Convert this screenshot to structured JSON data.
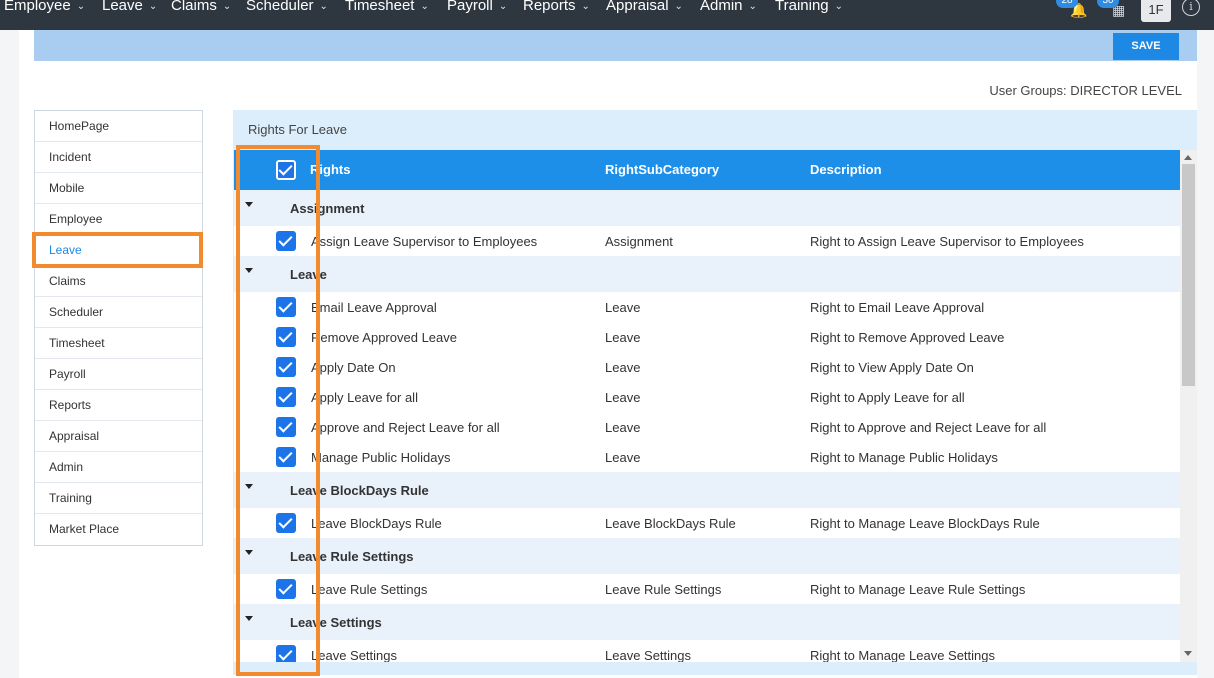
{
  "nav": {
    "items": [
      "Employee",
      "Leave",
      "Claims",
      "Scheduler",
      "Timesheet",
      "Payroll",
      "Reports",
      "Appraisal",
      "Admin",
      "Training"
    ],
    "notification_count": "28",
    "apps_count": "30",
    "user_initials": "1F"
  },
  "toolbar": {
    "save_label": "SAVE"
  },
  "user_groups": "User Groups: DIRECTOR LEVEL",
  "sidebar": {
    "items": [
      "HomePage",
      "Incident",
      "Mobile",
      "Employee",
      "Leave",
      "Claims",
      "Scheduler",
      "Timesheet",
      "Payroll",
      "Reports",
      "Appraisal",
      "Admin",
      "Training",
      "Market Place"
    ],
    "active": "Leave"
  },
  "panel": {
    "title": "Rights For Leave",
    "columns": {
      "rights": "Rights",
      "subcategory": "RightSubCategory",
      "description": "Description"
    },
    "groups": [
      {
        "name": "Assignment",
        "rows": [
          {
            "right": "Assign Leave Supervisor to Employees",
            "sub": "Assignment",
            "desc": "Right to Assign Leave Supervisor to Employees",
            "checked": true
          }
        ]
      },
      {
        "name": "Leave",
        "rows": [
          {
            "right": "Email Leave Approval",
            "sub": "Leave",
            "desc": "Right to Email Leave Approval",
            "checked": true
          },
          {
            "right": "Remove Approved Leave",
            "sub": "Leave",
            "desc": "Right to Remove Approved Leave",
            "checked": true
          },
          {
            "right": "Apply Date On",
            "sub": "Leave",
            "desc": "Right to View Apply Date On",
            "checked": true
          },
          {
            "right": "Apply Leave for all",
            "sub": "Leave",
            "desc": "Right to Apply Leave for all",
            "checked": true
          },
          {
            "right": "Approve and Reject Leave for all",
            "sub": "Leave",
            "desc": "Right to Approve and Reject Leave for all",
            "checked": true
          },
          {
            "right": "Manage Public Holidays",
            "sub": "Leave",
            "desc": "Right to Manage Public Holidays",
            "checked": true
          }
        ]
      },
      {
        "name": "Leave BlockDays Rule",
        "rows": [
          {
            "right": "Leave BlockDays Rule",
            "sub": "Leave BlockDays Rule",
            "desc": "Right to Manage Leave BlockDays Rule",
            "checked": true
          }
        ]
      },
      {
        "name": "Leave Rule Settings",
        "rows": [
          {
            "right": "Leave Rule Settings",
            "sub": "Leave Rule Settings",
            "desc": "Right to Manage Leave Rule Settings",
            "checked": true
          }
        ]
      },
      {
        "name": "Leave Settings",
        "rows": [
          {
            "right": "Leave Settings",
            "sub": "Leave Settings",
            "desc": "Right to Manage Leave Settings",
            "checked": true
          }
        ]
      }
    ]
  },
  "colors": {
    "nav_bg": "#2e3640",
    "accent": "#1e88e5",
    "highlight": "#f28a2e",
    "bar": "#a9cdf0"
  }
}
